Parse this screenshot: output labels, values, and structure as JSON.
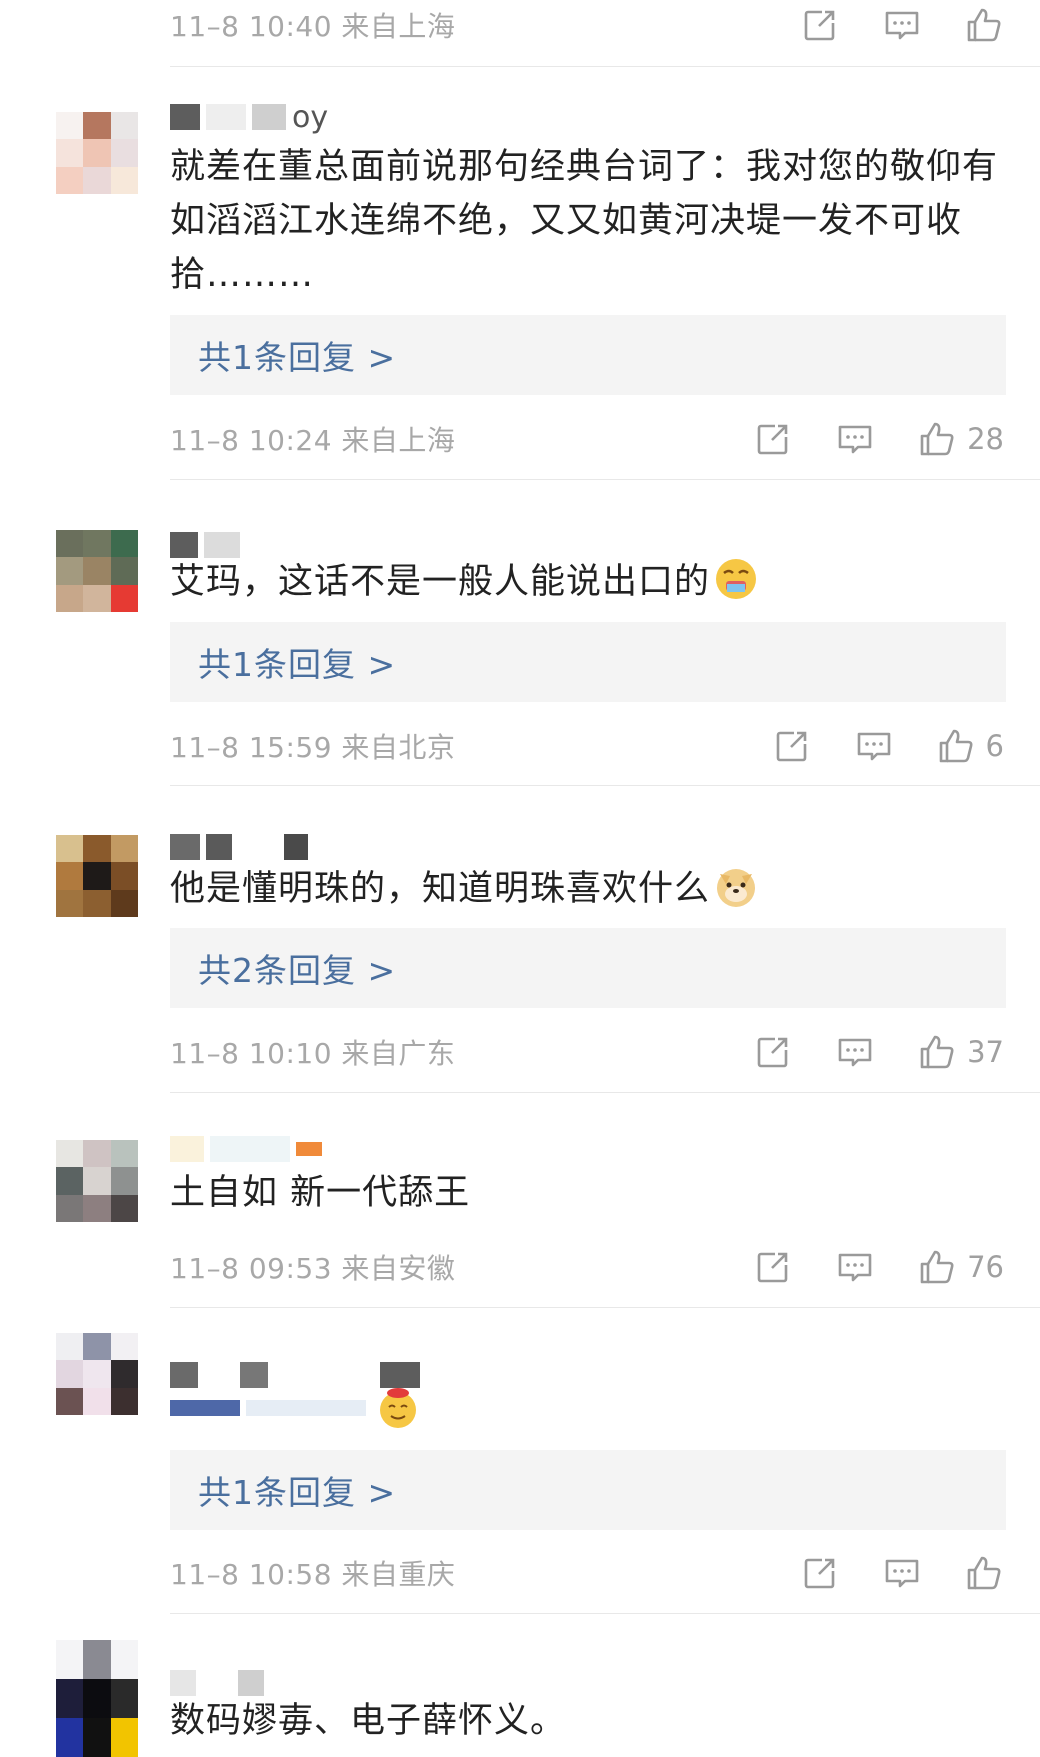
{
  "comments": [
    {
      "meta": "11–8 10:40  来自上海",
      "likes": ""
    },
    {
      "username_tail": "oy",
      "text": "就差在董总面前说那句经典台词了：我对您的敬仰有如滔滔江水连绵不绝，又又如黄河决堤一发不可收拾………",
      "reply": "共1条回复 >",
      "meta": "11–8 10:24  来自上海",
      "likes": "28"
    },
    {
      "text": "艾玛，这话不是一般人能说出口的",
      "reply": "共1条回复 >",
      "meta": "11–8 15:59  来自北京",
      "likes": "6"
    },
    {
      "text": "他是懂明珠的，知道明珠喜欢什么",
      "reply": "共2条回复 >",
      "meta": "11–8 10:10  来自广东",
      "likes": "37"
    },
    {
      "text": "土自如 新一代舔王",
      "meta": "11–8 09:53  来自安徽",
      "likes": "76"
    },
    {
      "reply": "共1条回复 >",
      "meta": "11–8 10:58  来自重庆",
      "likes": ""
    },
    {
      "text": "数码嫪毐、电子薛怀义。"
    }
  ],
  "colors": {
    "reply_link": "#4a6f9e",
    "meta_gray": "#a8a8a8",
    "reply_bg": "#f4f4f4"
  },
  "icons": [
    "share-icon",
    "comment-icon",
    "like-icon",
    "emoji-sweat",
    "emoji-doge",
    "emoji-666"
  ]
}
